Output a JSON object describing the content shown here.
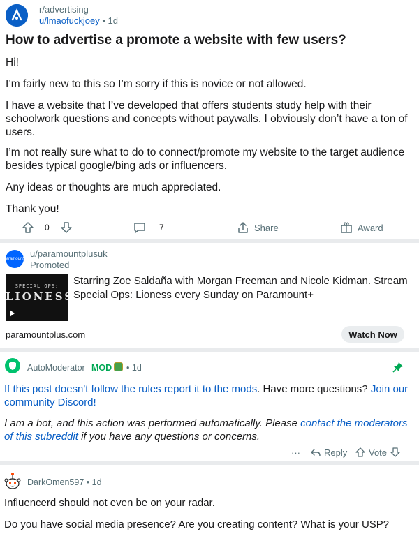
{
  "post": {
    "subreddit": "r/advertising",
    "author": "u/lmaofuckjoey",
    "separator": "•",
    "age": "1d",
    "title": "How to advertise a promote a website with few users?",
    "body": [
      "Hi!",
      "I’m fairly new to this so I’m sorry if this is novice or not allowed.",
      "I have a website that I’ve developed that offers students study help with their schoolwork questions and concepts without paywalls. I obviously don’t have a ton of users.",
      "I’m not really sure what to do to connect/promote my website to the target audience besides typical google/bing ads or influencers.",
      "Any ideas or thoughts are much appreciated.",
      "Thank you!"
    ],
    "vote_count": "0",
    "comment_count": "7",
    "share_label": "Share",
    "award_label": "Award",
    "icons": [
      "upvote-icon",
      "downvote-icon",
      "comment-icon",
      "share-icon",
      "award-icon"
    ]
  },
  "promoted": {
    "user": "u/paramountplusuk",
    "tag": "Promoted",
    "avatar_text": "Paramount+",
    "thumbnail": {
      "subtitle": "SPECIAL OPS:",
      "title": "LIONESS"
    },
    "text": "Starring Zoe Saldaña with Morgan Freeman and Nicole Kidman. Stream Special Ops: Lioness every Sunday on Paramount+",
    "domain": "paramountplus.com",
    "cta": "Watch Now"
  },
  "comments": [
    {
      "author": "AutoModerator",
      "role": "MOD",
      "separator": "•",
      "age": "1d",
      "pinned": true,
      "p1_link": "If this post doesn't follow the rules report it to the mods",
      "p1_text": ". Have more questions? ",
      "p1_link2": "Join our community Discord!",
      "p2_text": "I am a bot, and this action was performed automatically. Please ",
      "p2_link": "contact the moderators of this subreddit",
      "p2_tail": " if you have any questions or concerns.",
      "more_label": "···",
      "reply_label": "Reply",
      "vote_label": "Vote"
    },
    {
      "author": "DarkOmen597",
      "separator": "•",
      "age": "1d",
      "p1": "Influencerd should not even be on your radar.",
      "p2": "Do you have social media presence?  Are you creating content?  What is your USP?"
    }
  ],
  "colors": {
    "link": "#0a5fc6",
    "mod": "#00a854",
    "meta": "#576f76",
    "divider": "#e9ebed",
    "shield": "#00c26e"
  }
}
